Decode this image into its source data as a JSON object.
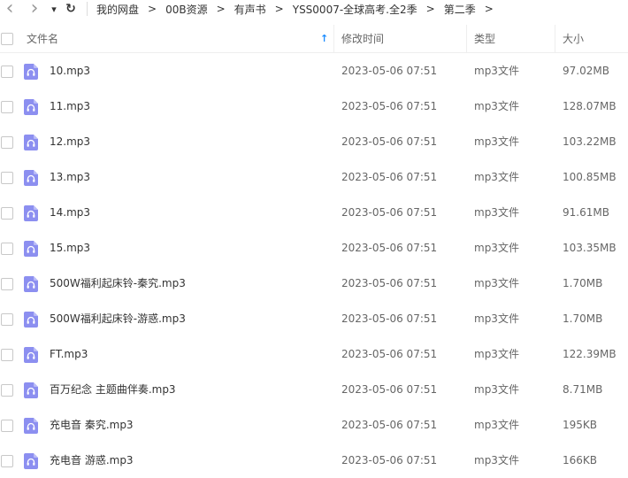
{
  "toolbar": {
    "back_glyph": "‹",
    "forward_glyph": "›",
    "dropdown_glyph": "▾",
    "refresh_glyph": "↻"
  },
  "breadcrumb": {
    "items": [
      "我的网盘",
      "00B资源",
      "有声书",
      "YSS0007-全球高考.全2季",
      "第二季"
    ],
    "separator": ">"
  },
  "header": {
    "name_label": "文件名",
    "sort_glyph": "↑",
    "time_label": "修改时间",
    "type_label": "类型",
    "size_label": "大小"
  },
  "colors": {
    "accent": "#1a8cff",
    "file_icon": "#8c8ff0"
  },
  "file_icon": "audio-file-icon",
  "files": [
    {
      "name": "10.mp3",
      "time": "2023-05-06 07:51",
      "type": "mp3文件",
      "size": "97.02MB"
    },
    {
      "name": "11.mp3",
      "time": "2023-05-06 07:51",
      "type": "mp3文件",
      "size": "128.07MB"
    },
    {
      "name": "12.mp3",
      "time": "2023-05-06 07:51",
      "type": "mp3文件",
      "size": "103.22MB"
    },
    {
      "name": "13.mp3",
      "time": "2023-05-06 07:51",
      "type": "mp3文件",
      "size": "100.85MB"
    },
    {
      "name": "14.mp3",
      "time": "2023-05-06 07:51",
      "type": "mp3文件",
      "size": "91.61MB"
    },
    {
      "name": "15.mp3",
      "time": "2023-05-06 07:51",
      "type": "mp3文件",
      "size": "103.35MB"
    },
    {
      "name": "500W福利起床铃-秦究.mp3",
      "time": "2023-05-06 07:51",
      "type": "mp3文件",
      "size": "1.70MB"
    },
    {
      "name": "500W福利起床铃-游惑.mp3",
      "time": "2023-05-06 07:51",
      "type": "mp3文件",
      "size": "1.70MB"
    },
    {
      "name": "FT.mp3",
      "time": "2023-05-06 07:51",
      "type": "mp3文件",
      "size": "122.39MB"
    },
    {
      "name": "百万纪念 主题曲伴奏.mp3",
      "time": "2023-05-06 07:51",
      "type": "mp3文件",
      "size": "8.71MB"
    },
    {
      "name": "充电音 秦究.mp3",
      "time": "2023-05-06 07:51",
      "type": "mp3文件",
      "size": "195KB"
    },
    {
      "name": "充电音 游惑.mp3",
      "time": "2023-05-06 07:51",
      "type": "mp3文件",
      "size": "166KB"
    }
  ]
}
